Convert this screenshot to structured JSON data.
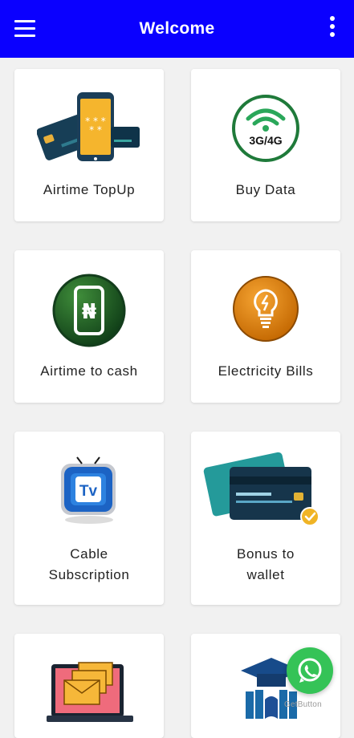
{
  "app_bar": {
    "title": "Welcome",
    "background": "#0a00ff",
    "menu_icon": "hamburger-menu-icon",
    "more_icon": "more-vertical-icon"
  },
  "services": [
    {
      "label_line1": "Airtime TopUp",
      "label_line2": "",
      "icon": "phone-and-cards-icon"
    },
    {
      "label_line1": "Buy Data",
      "label_line2": "",
      "icon": "wifi-3g-4g-icon"
    },
    {
      "label_line1": "Airtime to cash",
      "label_line2": "",
      "icon": "naira-phone-icon"
    },
    {
      "label_line1": "Electricity Bills",
      "label_line2": "",
      "icon": "lightbulb-icon"
    },
    {
      "label_line1": "Cable",
      "label_line2": "Subscription",
      "icon": "tv-icon"
    },
    {
      "label_line1": "Bonus to",
      "label_line2": "wallet",
      "icon": "credit-cards-icon"
    },
    {
      "label_line1": "",
      "label_line2": "",
      "icon": "envelopes-laptop-icon"
    },
    {
      "label_line1": "",
      "label_line2": "",
      "icon": "graduation-books-icon"
    }
  ],
  "whatsapp_button": {
    "icon": "whatsapp-icon",
    "color": "#35c357"
  },
  "watermark": "GetButton"
}
